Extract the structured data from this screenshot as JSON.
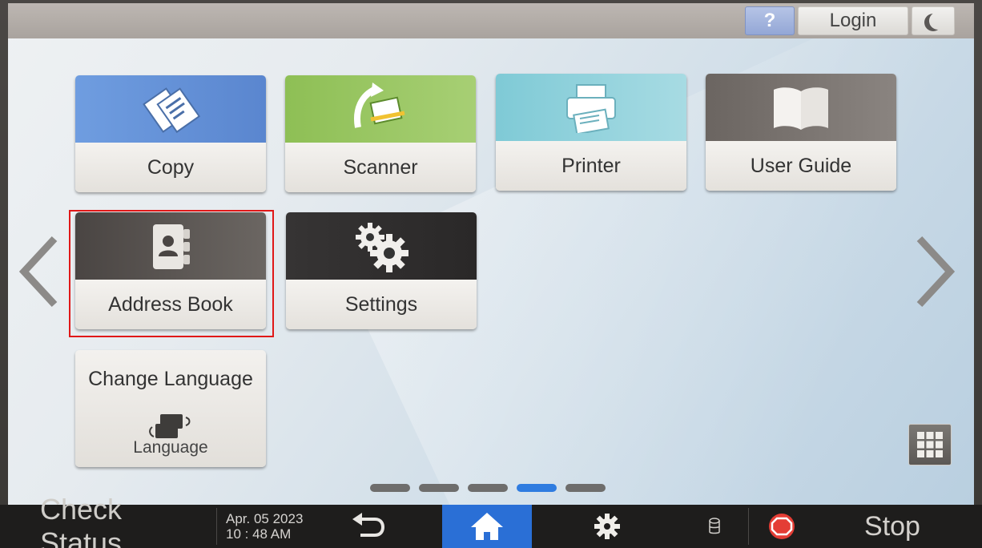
{
  "topbar": {
    "help_label": "?",
    "login_label": "Login"
  },
  "tiles": [
    {
      "label": "Copy"
    },
    {
      "label": "Scanner"
    },
    {
      "label": "Printer"
    },
    {
      "label": "User Guide"
    },
    {
      "label": "Address Book"
    },
    {
      "label": "Settings"
    }
  ],
  "language_tile": {
    "title": "Change Language",
    "subtitle": "Language"
  },
  "pager": {
    "pages": 5,
    "current": 4
  },
  "bottombar": {
    "check_status": "Check Status",
    "date": "Apr. 05 2023",
    "time": "10 : 48 AM",
    "stop": "Stop"
  },
  "colors": {
    "home_accent": "#2a6fd6",
    "highlight": "#e01818",
    "pager_active": "#2f7ce0"
  }
}
